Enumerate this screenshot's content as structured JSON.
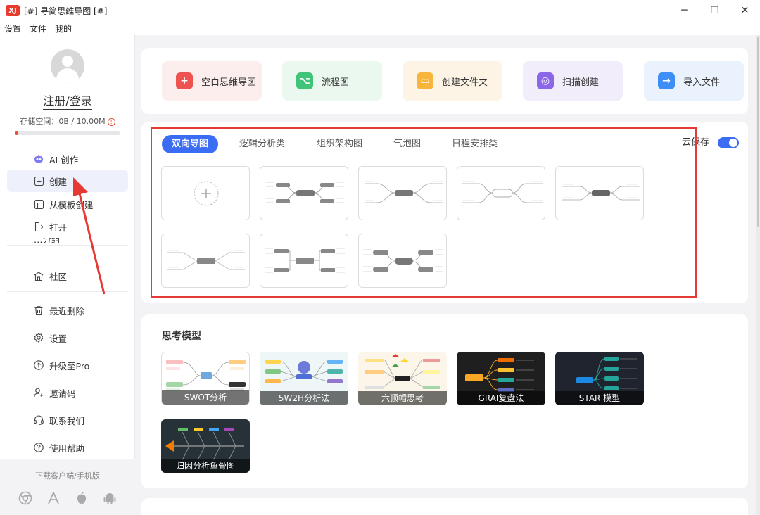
{
  "window": {
    "logo_text": "XJ",
    "title": "[#] 寻简思维导图 [#]",
    "controls": [
      "─",
      "☐",
      "✕"
    ]
  },
  "menu": [
    "设置",
    "文件",
    "我的"
  ],
  "sidebar": {
    "login": "注册/登录",
    "storage": "存储空间：0B / 10.00M",
    "storage_warn_glyph": "!",
    "storage_used_fraction": 0.03,
    "partial_item": "…分组",
    "items": [
      {
        "label": "AI 创作",
        "icon": "ai-robot-icon"
      },
      {
        "label": "创建",
        "icon": "plus-square-icon"
      },
      {
        "label": "从模板创建",
        "icon": "template-icon"
      },
      {
        "label": "打开",
        "icon": "open-file-icon"
      },
      {
        "label": "社区",
        "icon": "community-icon"
      },
      {
        "label": "最近删除",
        "icon": "trash-icon"
      },
      {
        "label": "设置",
        "icon": "gear-icon"
      },
      {
        "label": "升级至Pro",
        "icon": "upgrade-arrow-icon"
      },
      {
        "label": "邀请码",
        "icon": "user-plus-icon"
      },
      {
        "label": "联系我们",
        "icon": "headset-icon"
      },
      {
        "label": "使用帮助",
        "icon": "help-circle-icon"
      }
    ],
    "download_text": "下载客户端/手机版",
    "platforms": [
      "chrome-icon",
      "app-store-icon",
      "apple-icon",
      "android-icon"
    ]
  },
  "quick_actions": [
    {
      "label": "空白思维导图",
      "icon_glyph": "+",
      "color": "#ef5350",
      "bg": "#fdeeee"
    },
    {
      "label": "流程图",
      "icon_glyph": "⌥",
      "color": "#3fc47a",
      "bg": "#eaf8ef"
    },
    {
      "label": "创建文件夹",
      "icon_glyph": "▭",
      "color": "#f7b53b",
      "bg": "#fdf4e6"
    },
    {
      "label": "扫描创建",
      "icon_glyph": "◎",
      "color": "#8b66e8",
      "bg": "#f1edfb"
    },
    {
      "label": "导入文件",
      "icon_glyph": "→",
      "color": "#3e8ef7",
      "bg": "#eaf2fd"
    }
  ],
  "template_tabs": [
    "双向导图",
    "逻辑分析类",
    "组织架构图",
    "气泡图",
    "日程安排类"
  ],
  "cloud_save": {
    "label": "云保存",
    "enabled": true,
    "accent": "#3a6cf4"
  },
  "thinking_models": {
    "title": "思考模型",
    "items": [
      {
        "label": "SWOT分析",
        "bg": "#ffffff"
      },
      {
        "label": "5W2H分析法",
        "bg": "#eef6f8"
      },
      {
        "label": "六顶帽思考",
        "bg": "#fbf6e9"
      },
      {
        "label": "GRAI复盘法",
        "bg": "#1f1f1f"
      },
      {
        "label": "STAR 模型",
        "bg": "#20242e"
      },
      {
        "label": "归因分析鱼骨图",
        "bg": "#263238"
      }
    ]
  }
}
